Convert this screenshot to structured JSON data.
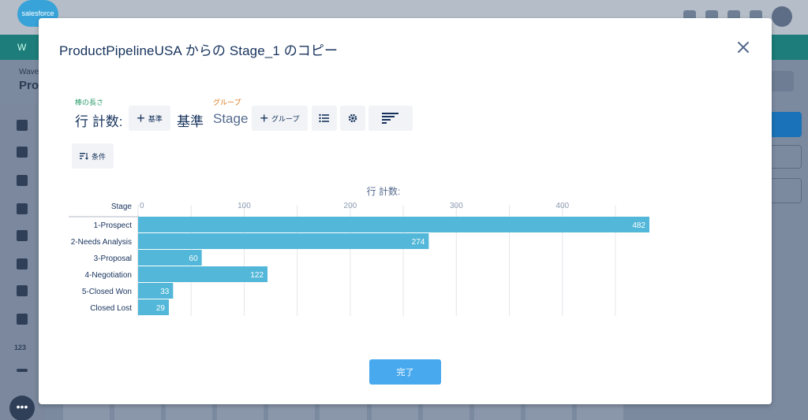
{
  "background": {
    "logo_text": "salesforce",
    "header_small": "Wave",
    "header_big": "Prod",
    "teal_text": "W",
    "sidebar_numeric_label": "123",
    "fab_label": "•••",
    "icons": [
      "apps-icon",
      "help-icon",
      "settings-icon",
      "bell-icon",
      "avatar-icon"
    ]
  },
  "modal": {
    "title": "ProductPipelineUSA からの Stage_1 のコピー",
    "close_icon": "close-icon",
    "measure": {
      "label": "棒の長さ",
      "value": "行 計数:",
      "add_label": "基準",
      "suffix": "基準"
    },
    "group": {
      "label": "グループ",
      "value": "Stage",
      "add_label": "グループ"
    },
    "toolbar_icons": [
      "list-icon",
      "gear-icon",
      "sort-bars-icon"
    ],
    "filter": {
      "label": "条件"
    },
    "done_label": "完了"
  },
  "chart_data": {
    "type": "bar",
    "orientation": "horizontal",
    "title": "行 計数:",
    "ylabel": "Stage",
    "categories": [
      "1-Prospect",
      "2-Needs Analysis",
      "3-Proposal",
      "4-Negotiation",
      "5-Closed Won",
      "Closed Lost"
    ],
    "values": [
      482,
      274,
      60,
      122,
      33,
      29
    ],
    "xlim": [
      0,
      482
    ],
    "xticks": [
      0,
      100,
      200,
      300,
      400
    ],
    "grid": true,
    "bar_color": "#52b7d8",
    "legend": "none"
  }
}
